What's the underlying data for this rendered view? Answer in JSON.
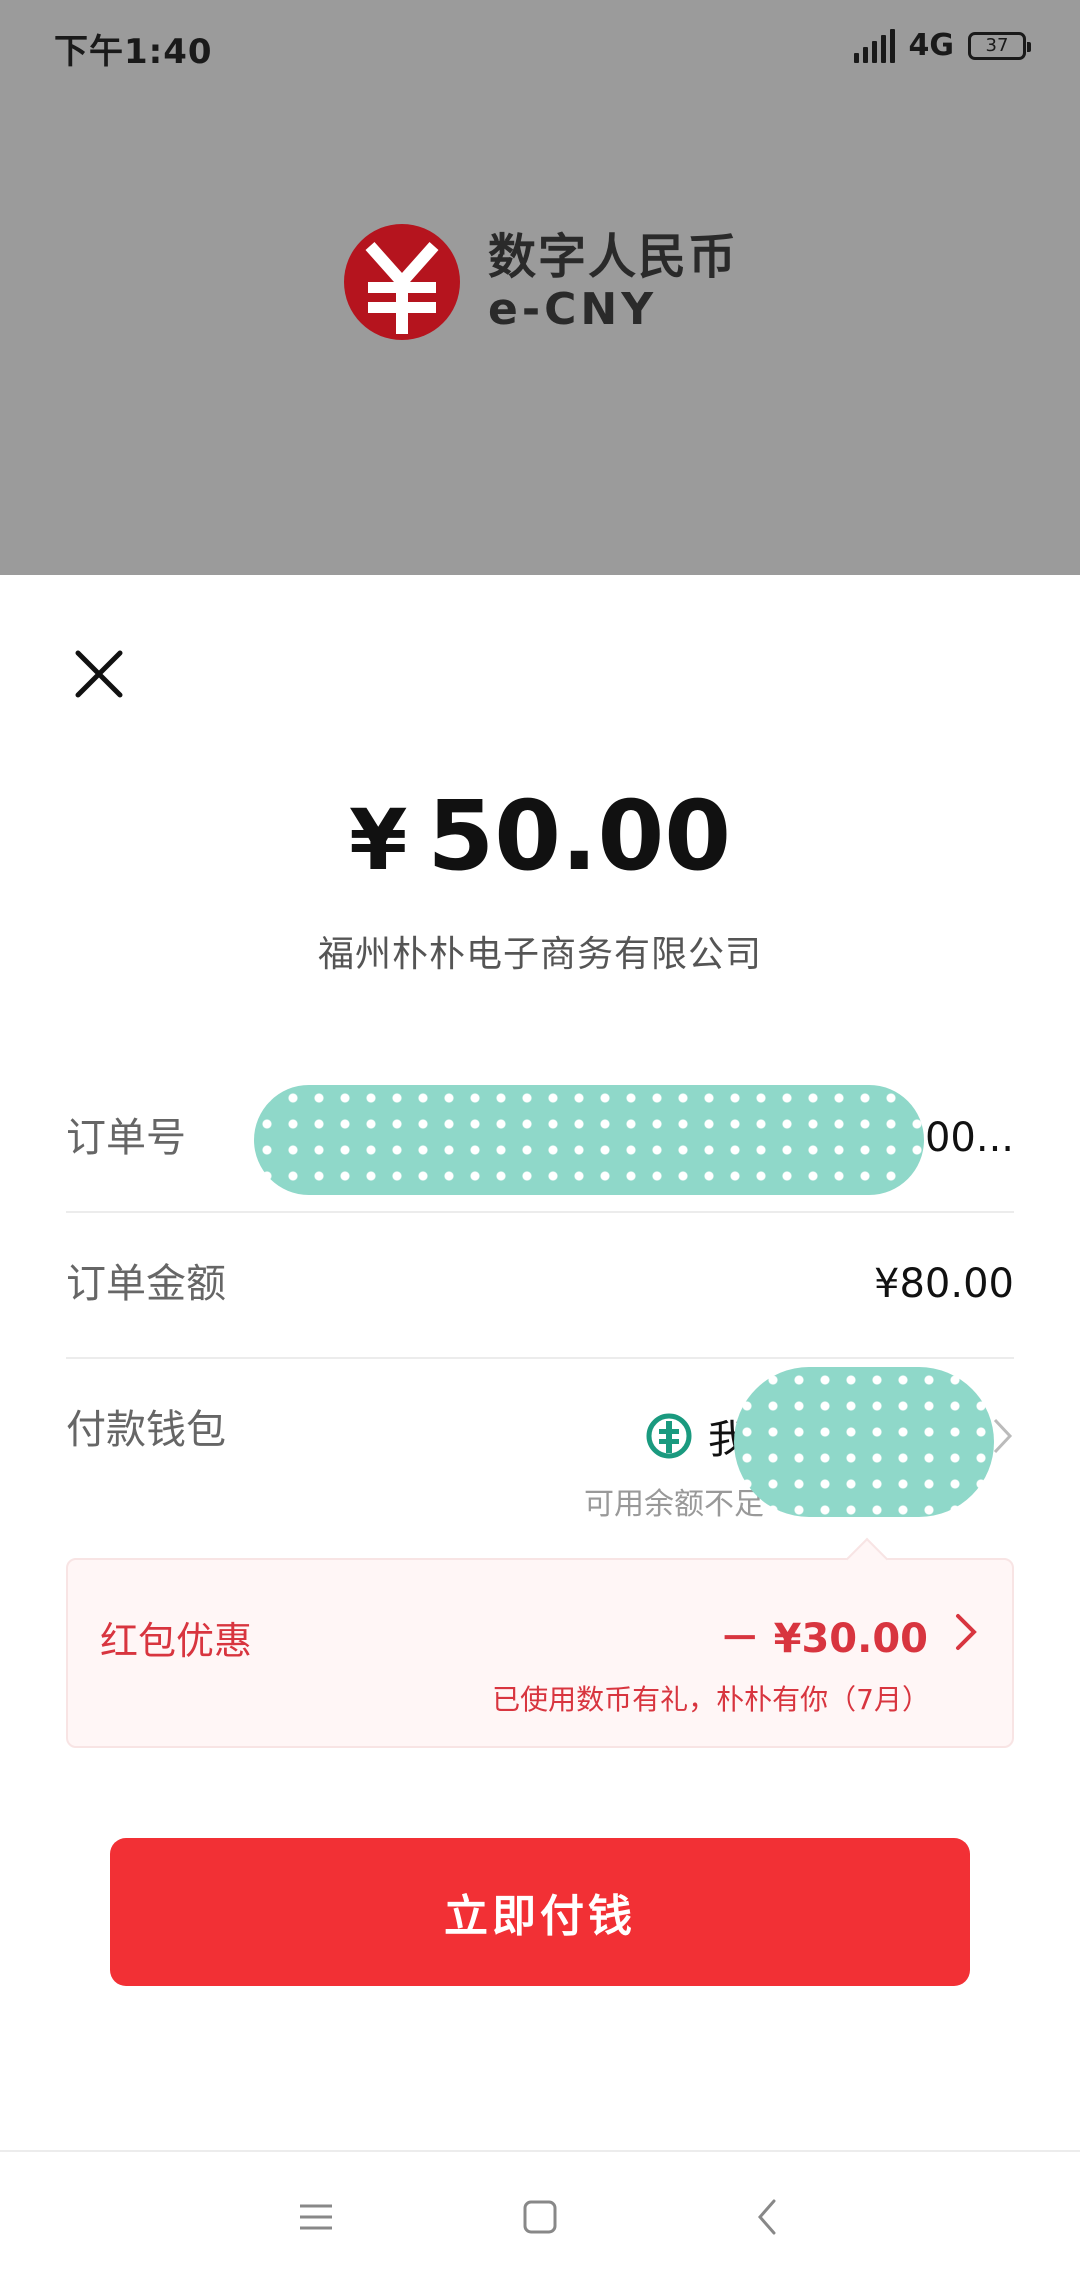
{
  "status_bar": {
    "time": "下午1:40",
    "network": "4G",
    "battery": "37"
  },
  "brand": {
    "name_cn": "数字人民币",
    "name_en": "e-CNY",
    "logo_color": "#b5141e"
  },
  "payment": {
    "currency_symbol": "¥",
    "amount": "50.00",
    "merchant": "福州朴朴电子商务有限公司",
    "rows": {
      "order_no": {
        "label": "订单号",
        "value": "00..."
      },
      "order_amount": {
        "label": "订单金额",
        "value": "¥80.00"
      },
      "wallet": {
        "label": "付款钱包",
        "value": "我的钱",
        "note": "可用余额不足"
      }
    },
    "promo": {
      "label": "红包优惠",
      "amount": "－ ¥30.00",
      "note": "已使用数币有礼，朴朴有你（7月）"
    },
    "pay_button": "立即付钱"
  },
  "colors": {
    "accent": "#f23035",
    "promo_text": "#d8353f",
    "bank_icon": "#1a9a7f",
    "redaction": "#8fd8c9"
  },
  "icons": {
    "close": "close-icon",
    "bank": "bank-icon",
    "chevron": "chevron-right-icon",
    "nav_menu": "menu-icon",
    "nav_home": "home-icon",
    "nav_back": "back-icon"
  }
}
